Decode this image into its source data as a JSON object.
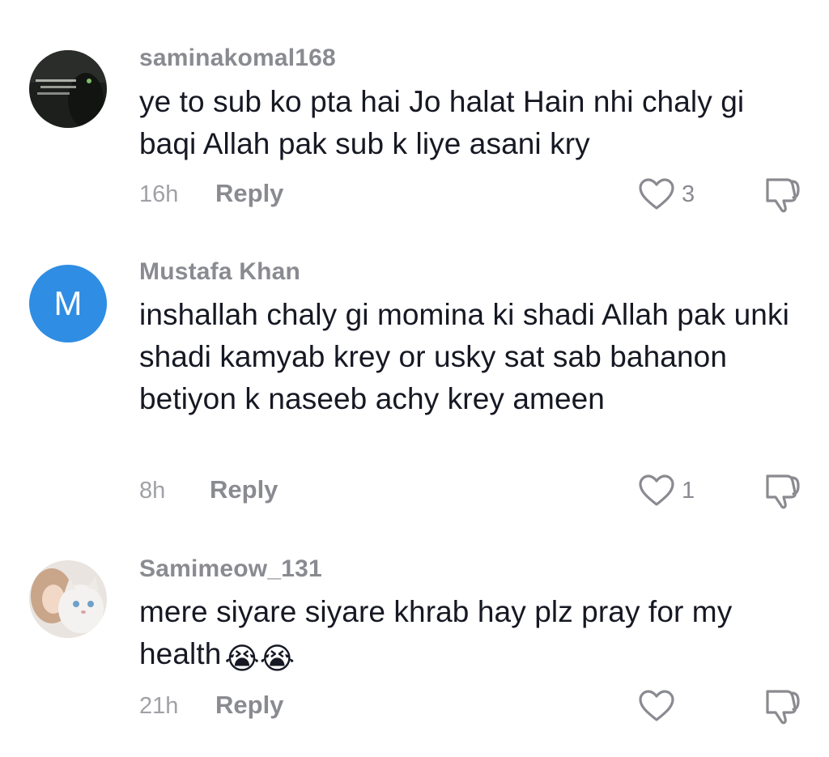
{
  "comments": [
    {
      "username": "saminakomal168",
      "text": "ye to sub ko pta hai Jo halat Hain nhi chaly gi baqi Allah pak sub k liye asani kry",
      "time": "16h",
      "reply_label": "Reply",
      "likes": "3",
      "avatar": "dark-image-avatar"
    },
    {
      "username": "Mustafa Khan",
      "text": "inshallah chaly gi momina ki shadi Allah pak unki shadi kamyab krey or usky sat sab bahanon betiyon k naseeb achy krey ameen",
      "time": "8h",
      "reply_label": "Reply",
      "likes": "1",
      "avatar_letter": "M",
      "avatar_color": "#2f8de4"
    },
    {
      "username": "Samimeow_131",
      "text": "mere siyare siyare khrab hay plz pray for my health",
      "emoji": "😭😭",
      "time": "21h",
      "reply_label": "Reply",
      "likes": "",
      "avatar": "girl-with-cat-avatar"
    }
  ],
  "icons": {
    "like": "heart-outline-icon",
    "dislike": "thumbs-down-icon"
  }
}
